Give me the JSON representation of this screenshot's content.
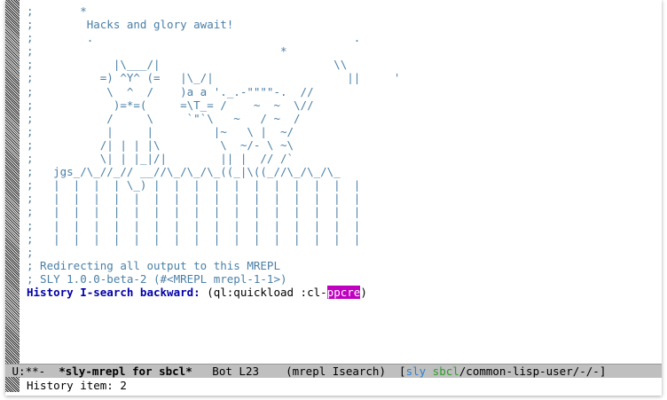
{
  "banner": {
    "art_lines": [
      ";       *",
      ";        Hacks and glory await!",
      ";        .                                       .",
      ";                                     *       ",
      ";            |\\___/|                          \\\\",
      ";          =) ^Y^ (=   |\\_/|                    ||     '",
      ";           \\  ^  /    )a a '._.-\"\"\"\"-.  //",
      ";            )=*=(     =\\T_= /    ~  ~  \\//",
      ";           /     \\     `\"`\\   ~   / ~  /",
      ";           |     |         |~   \\ |  ~/",
      ";          /| | | |\\         \\  ~/- \\ ~\\",
      ";          \\| | |_|/|        || |  // /`",
      ";   jgs_/\\_//_// __//\\_/\\_/\\_((_|\\((_//\\_/\\_/\\_",
      ";   |  |  |  | \\_) |  |  |  |  |  |  |  |  |  |  |",
      ";   |  |  |  |  |  |  |  |  |  |  |  |  |  |  |  |",
      ";   |  |  |  |  |  |  |  |  |  |  |  |  |  |  |  |",
      ";   |  |  |  |  |  |  |  |  |  |  |  |  |  |  |  |",
      ";   |  |  |  |  |  |  |  |  |  |  |  |  |  |  |  |",
      ";"
    ]
  },
  "repl": {
    "redirect_line": "; Redirecting all output to this MREPL",
    "version_line": "; SLY 1.0.0-beta-2 (#<MREPL mrepl-1-1>)",
    "isearch_prompt": "History I-search backward:",
    "isearch_text": " (ql:quickload :cl-",
    "isearch_match": "ppcre",
    "isearch_tail": ")"
  },
  "modeline": {
    "status": " U:**-  ",
    "buffer_name": "*sly-mrepl for sbcl*",
    "position": "   Bot L23    ",
    "modes": "(mrepl Isearch)  ",
    "bracket_open": "[",
    "sly": "sly",
    "space": " ",
    "sbcl": "sbcl",
    "path": "/common-lisp-user/-/-]"
  },
  "minibuffer": {
    "message": "History item: 2"
  },
  "colors": {
    "comment": "#4a7fa7",
    "prompt": "#0000a8",
    "match_bg": "#c000c0",
    "modeline_bg": "#bfbfbf"
  }
}
